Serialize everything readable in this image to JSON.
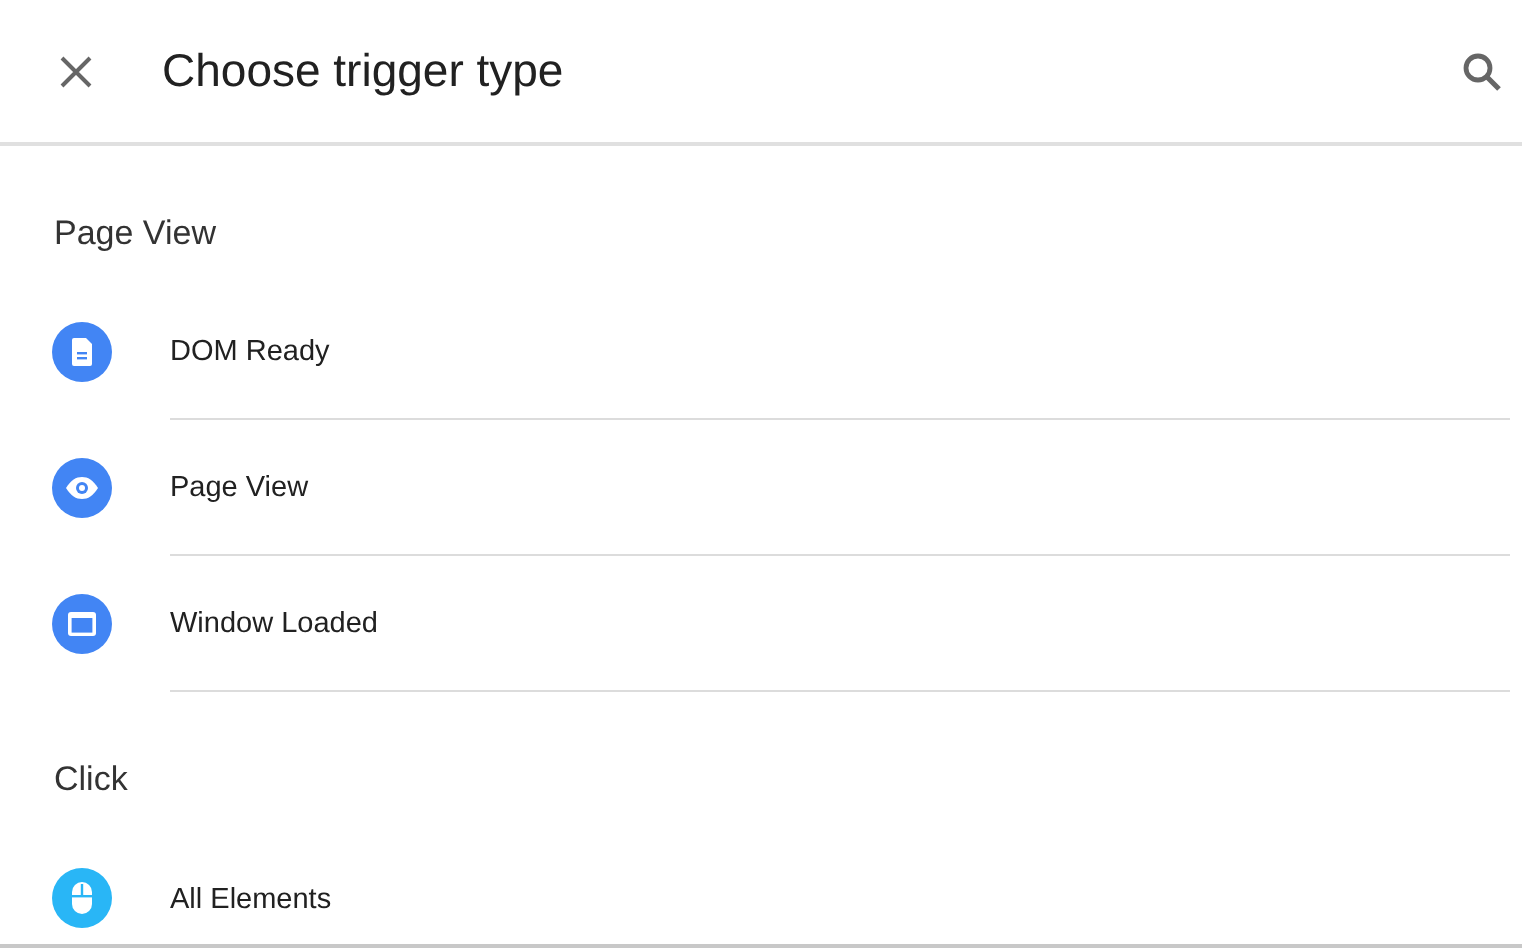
{
  "header": {
    "title": "Choose trigger type"
  },
  "sections": [
    {
      "title": "Page View",
      "items": [
        {
          "label": "DOM Ready",
          "kind": "document",
          "color": "#4285f4"
        },
        {
          "label": "Page View",
          "kind": "eye",
          "color": "#4285f4"
        },
        {
          "label": "Window Loaded",
          "kind": "window",
          "color": "#4285f4"
        }
      ]
    },
    {
      "title": "Click",
      "items": [
        {
          "label": "All Elements",
          "kind": "mouse",
          "color": "#29b6f6"
        }
      ]
    }
  ]
}
